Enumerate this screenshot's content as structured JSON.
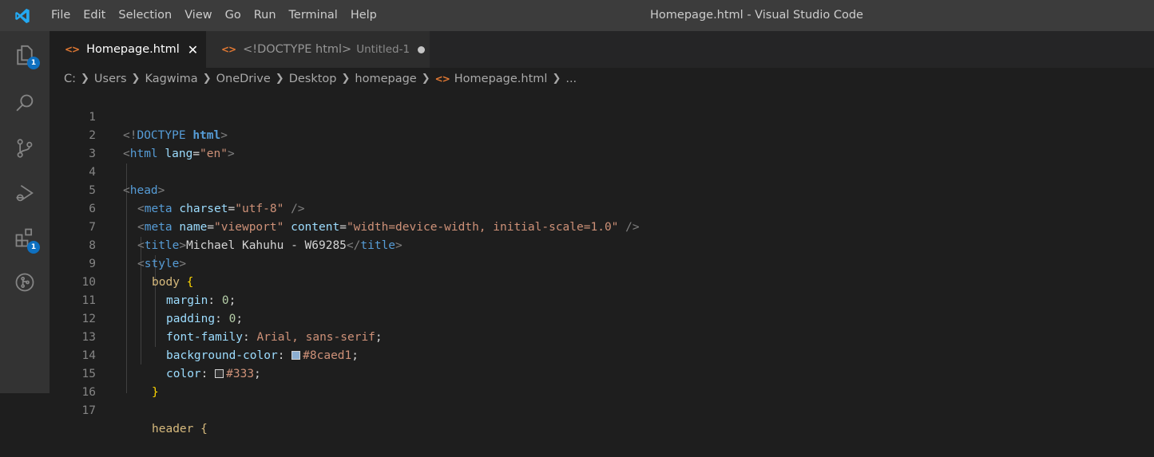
{
  "window": {
    "title": "Homepage.html - Visual Studio Code"
  },
  "menu": [
    "File",
    "Edit",
    "Selection",
    "View",
    "Go",
    "Run",
    "Terminal",
    "Help"
  ],
  "activity_bar": {
    "items": [
      {
        "icon": "explorer-files-icon",
        "badge": "1"
      },
      {
        "icon": "search-icon"
      },
      {
        "icon": "source-control-icon"
      },
      {
        "icon": "run-debug-icon"
      },
      {
        "icon": "extensions-icon",
        "badge": "1"
      },
      {
        "icon": "github-actions-icon"
      }
    ]
  },
  "tabs": [
    {
      "label": "Homepage.html",
      "active": true,
      "close": "✕"
    },
    {
      "label": "<!DOCTYPE html>",
      "description": "Untitled-1",
      "dirty": true
    }
  ],
  "breadcrumb": [
    "C:",
    "Users",
    "Kagwima",
    "OneDrive",
    "Desktop",
    "homepage",
    "Homepage.html",
    "..."
  ],
  "code": {
    "line_numbers": [
      "1",
      "2",
      "3",
      "4",
      "5",
      "6",
      "7",
      "8",
      "9",
      "10",
      "11",
      "12",
      "13",
      "14",
      "15",
      "16",
      "17"
    ],
    "l1": {
      "bracket_open": "<!",
      "kw": "DOCTYPE ",
      "tag": "html",
      "bracket_close": ">"
    },
    "l2": {
      "open": "<",
      "tag": "html",
      "attr": " lang",
      "eq": "=",
      "val": "\"en\"",
      "close": ">"
    },
    "l4": {
      "open": "<",
      "tag": "head",
      "close": ">"
    },
    "l5": {
      "open": "<",
      "tag": "meta",
      "attr": " charset",
      "eq": "=",
      "val": "\"utf-8\"",
      "close": " />"
    },
    "l6": {
      "open": "<",
      "tag": "meta",
      "attr1": " name",
      "eq1": "=",
      "val1": "\"viewport\"",
      "attr2": " content",
      "eq2": "=",
      "val2": "\"width=device-width, initial-scale=1.0\"",
      "close": " />"
    },
    "l7": {
      "open": "<",
      "tag": "title",
      "close": ">",
      "text": "Michael Kahuhu - W69285",
      "end_open": "</",
      "end_tag": "title",
      "end_close": ">"
    },
    "l8": {
      "open": "<",
      "tag": "style",
      "close": ">"
    },
    "l9": {
      "selector": "body ",
      "brace": "{"
    },
    "l10": {
      "prop": "margin",
      "colon": ": ",
      "value": "0",
      "semi": ";"
    },
    "l11": {
      "prop": "padding",
      "colon": ": ",
      "value": "0",
      "semi": ";"
    },
    "l12": {
      "prop": "font-family",
      "colon": ": ",
      "value": "Arial, sans-serif",
      "semi": ";"
    },
    "l13": {
      "prop": "background-color",
      "colon": ": ",
      "value": "#8caed1",
      "semi": ";"
    },
    "l14": {
      "prop": "color",
      "colon": ": ",
      "value": "#333",
      "semi": ";"
    },
    "l15": {
      "brace": "}"
    },
    "l17": {
      "selector": "header {"
    }
  },
  "colors": {
    "swatch_background": "#8caed1",
    "swatch_color": "#333333",
    "accent_badge": "#0e70c0"
  }
}
